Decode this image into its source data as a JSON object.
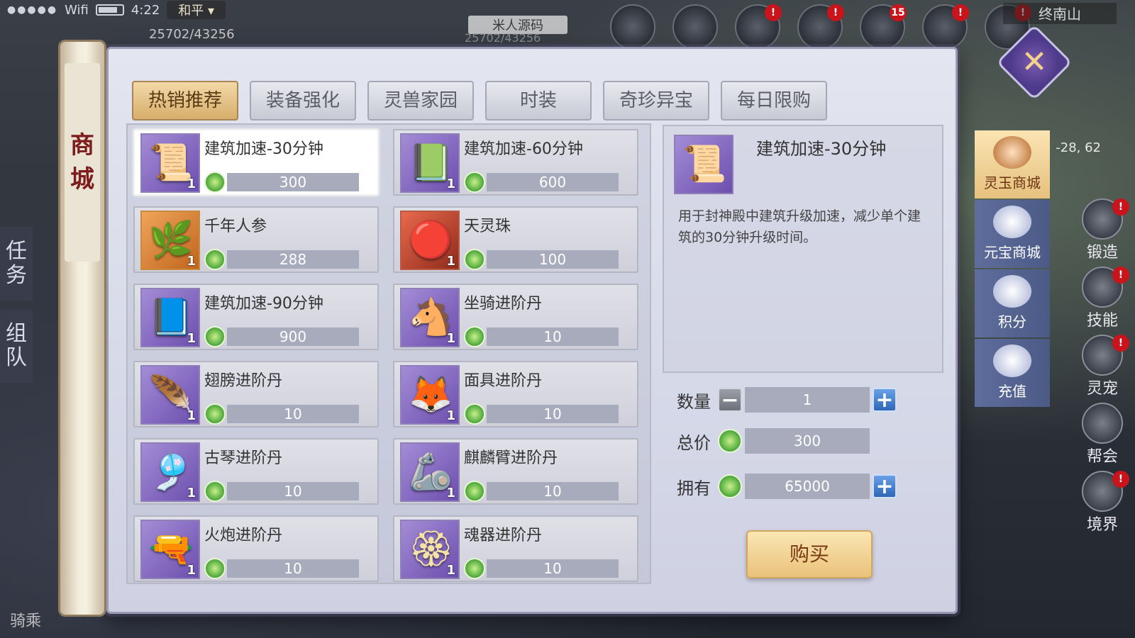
{
  "status": {
    "wifi": "Wifi",
    "time": "4:22",
    "mode": "和平",
    "hp": "25702/43256"
  },
  "target": {
    "name": "米人源码",
    "hp": "25702/43256"
  },
  "top_icons": [
    {
      "name": "event-icon",
      "badge": ""
    },
    {
      "name": "battle-icon",
      "badge": ""
    },
    {
      "name": "skill-icon",
      "badge": "!"
    },
    {
      "name": "mask-icon",
      "badge": "!"
    },
    {
      "name": "sword-icon",
      "badge": "15"
    },
    {
      "name": "meditate-icon",
      "badge": "!"
    },
    {
      "name": "treasure-icon",
      "badge": "!"
    }
  ],
  "location": "终南山",
  "coords": "-28, 62",
  "left_side": {
    "task": "任务",
    "team": "组队"
  },
  "bottom_left": "骑乘",
  "right_actions": [
    {
      "label": "锻造",
      "badge": "!"
    },
    {
      "label": "技能",
      "badge": "!"
    },
    {
      "label": "灵宠",
      "badge": "!"
    },
    {
      "label": "帮会",
      "badge": ""
    },
    {
      "label": "境界",
      "badge": "!"
    }
  ],
  "shop": {
    "scroll_title": [
      "商",
      "城"
    ],
    "close": "✕",
    "tabs": [
      "热销推荐",
      "装备强化",
      "灵兽家园",
      "时装",
      "奇珍异宝",
      "每日限购"
    ],
    "active_tab": 0,
    "items": [
      {
        "name": "建筑加速-30分钟",
        "price": "300",
        "count": "1",
        "icon": "scroll-icon",
        "color": "purple",
        "symbol": "📜"
      },
      {
        "name": "建筑加速-60分钟",
        "price": "600",
        "count": "1",
        "icon": "scroll-icon",
        "color": "purple",
        "symbol": "📗"
      },
      {
        "name": "千年人参",
        "price": "288",
        "count": "1",
        "icon": "ginseng-icon",
        "color": "orange",
        "symbol": "🌿"
      },
      {
        "name": "天灵珠",
        "price": "100",
        "count": "1",
        "icon": "orb-icon",
        "color": "red",
        "symbol": "🔴"
      },
      {
        "name": "建筑加速-90分钟",
        "price": "900",
        "count": "1",
        "icon": "scroll-icon",
        "color": "purple",
        "symbol": "📘"
      },
      {
        "name": "坐骑进阶丹",
        "price": "10",
        "count": "1",
        "icon": "horse-icon",
        "color": "purple",
        "symbol": "🐴"
      },
      {
        "name": "翅膀进阶丹",
        "price": "10",
        "count": "1",
        "icon": "feather-icon",
        "color": "purple",
        "symbol": "🪶"
      },
      {
        "name": "面具进阶丹",
        "price": "10",
        "count": "1",
        "icon": "mask-icon",
        "color": "purple",
        "symbol": "🦊"
      },
      {
        "name": "古琴进阶丹",
        "price": "10",
        "count": "1",
        "icon": "lyre-icon",
        "color": "purple",
        "symbol": "🎐"
      },
      {
        "name": "麒麟臂进阶丹",
        "price": "10",
        "count": "1",
        "icon": "arm-icon",
        "color": "purple",
        "symbol": "🦾"
      },
      {
        "name": "火炮进阶丹",
        "price": "10",
        "count": "1",
        "icon": "cannon-icon",
        "color": "purple",
        "symbol": "🔫"
      },
      {
        "name": "魂器进阶丹",
        "price": "10",
        "count": "1",
        "icon": "soul-icon",
        "color": "purple",
        "symbol": "🏵"
      }
    ],
    "selected_index": 0,
    "detail": {
      "name": "建筑加速-30分钟",
      "symbol": "📜",
      "description": "用于封神殿中建筑升级加速，减少单个建筑的30分钟升级时间。"
    },
    "quantity_label": "数量",
    "quantity": "1",
    "total_label": "总价",
    "total": "300",
    "owned_label": "拥有",
    "owned": "65000",
    "buy_label": "购买",
    "side_nav": [
      {
        "label": "灵玉商城",
        "active": true
      },
      {
        "label": "元宝商城",
        "active": false
      },
      {
        "label": "积分",
        "active": false
      },
      {
        "label": "充值",
        "active": false
      }
    ]
  }
}
